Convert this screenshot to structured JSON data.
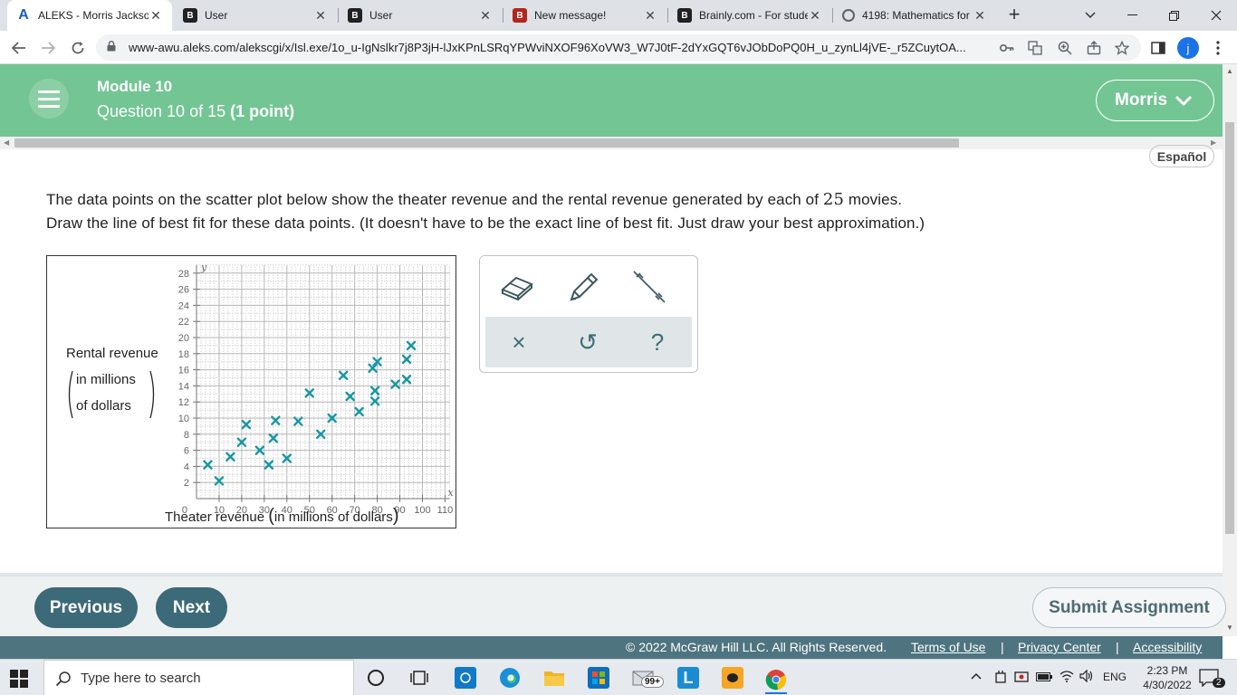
{
  "browser": {
    "tabs": [
      {
        "title": "ALEKS - Morris Jackson",
        "icon": "aleks-icon",
        "active": true
      },
      {
        "title": "User",
        "icon": "brainly-icon",
        "active": false
      },
      {
        "title": "User",
        "icon": "brainly-icon",
        "active": false
      },
      {
        "title": "New message!",
        "icon": "brainly-icon",
        "active": false
      },
      {
        "title": "Brainly.com - For students",
        "icon": "brainly-icon",
        "active": false
      },
      {
        "title": "4198: Mathematics for",
        "icon": "globe-icon",
        "active": false
      }
    ],
    "url": "www-awu.aleks.com/alekscgi/x/Isl.exe/1o_u-IgNslkr7j8P3jH-lJxKPnLSRqYPWviNXOF96XoVW3_W7J0tF-2dYxGQT6vJObDoPQ0H_u_zynLl4jVE-_r5ZCuytOA...",
    "profile_initial": "j"
  },
  "header": {
    "module": "Module 10",
    "question_text": "Question 10 of 15",
    "points": "(1 point)",
    "user_name": "Morris"
  },
  "language_button": "Español",
  "question": {
    "line1_pre": "The data points on the scatter plot below show the theater revenue and the rental revenue generated by each of",
    "line1_count": "25",
    "line1_post": "movies.",
    "line2": "Draw the line of best fit for these data points. (It doesn't have to be the exact line of best fit. Just draw your best approximation.)"
  },
  "chart_data": {
    "type": "scatter",
    "xlabel_main": "Theater revenue",
    "xlabel_sub": "in millions of dollars",
    "ylabel_main": "Rental revenue",
    "ylabel_sub1": "in millions",
    "ylabel_sub2": "of dollars",
    "x_axis_letter": "x",
    "y_axis_letter": "y",
    "origin_label": "0",
    "xlim": [
      0,
      112
    ],
    "ylim": [
      0,
      29
    ],
    "x_ticks": [
      10,
      20,
      30,
      40,
      50,
      60,
      70,
      80,
      90,
      100,
      110
    ],
    "y_ticks": [
      2,
      4,
      6,
      8,
      10,
      12,
      14,
      16,
      18,
      20,
      22,
      24,
      26,
      28
    ],
    "grid": true,
    "marker": "x",
    "marker_color": "#1797a6",
    "points": [
      {
        "x": 5,
        "y": 4.2
      },
      {
        "x": 10,
        "y": 2.2
      },
      {
        "x": 15,
        "y": 5.2
      },
      {
        "x": 20,
        "y": 7
      },
      {
        "x": 22,
        "y": 9.2
      },
      {
        "x": 28,
        "y": 6
      },
      {
        "x": 32,
        "y": 4.2
      },
      {
        "x": 35,
        "y": 9.7
      },
      {
        "x": 34,
        "y": 7.5
      },
      {
        "x": 40,
        "y": 5
      },
      {
        "x": 45,
        "y": 9.6
      },
      {
        "x": 50,
        "y": 13.1
      },
      {
        "x": 55,
        "y": 8
      },
      {
        "x": 60,
        "y": 10
      },
      {
        "x": 65,
        "y": 15.3
      },
      {
        "x": 68,
        "y": 12.7
      },
      {
        "x": 72,
        "y": 10.8
      },
      {
        "x": 78,
        "y": 16.2
      },
      {
        "x": 80,
        "y": 17
      },
      {
        "x": 79,
        "y": 13.4
      },
      {
        "x": 79,
        "y": 12.1
      },
      {
        "x": 88,
        "y": 14.2
      },
      {
        "x": 93,
        "y": 17.3
      },
      {
        "x": 95,
        "y": 19
      },
      {
        "x": 93,
        "y": 14.8
      }
    ]
  },
  "tools": {
    "eraser": "eraser-icon",
    "pencil": "pencil-icon",
    "line": "line-tool-icon",
    "clear": "×",
    "undo": "↺",
    "help": "?"
  },
  "footer": {
    "previous": "Previous",
    "next": "Next",
    "submit": "Submit Assignment",
    "copyright": "© 2022 McGraw Hill LLC. All Rights Reserved.",
    "terms": "Terms of Use",
    "privacy": "Privacy Center",
    "accessibility": "Accessibility"
  },
  "taskbar": {
    "search_placeholder": "Type here to search",
    "mail_badge": "99+",
    "language": "ENG",
    "time": "2:23 PM",
    "date": "4/30/2022",
    "notifications": "2"
  },
  "colors": {
    "header_green": "#73c594",
    "button_teal": "#3c6a78",
    "marker": "#1797a6"
  }
}
